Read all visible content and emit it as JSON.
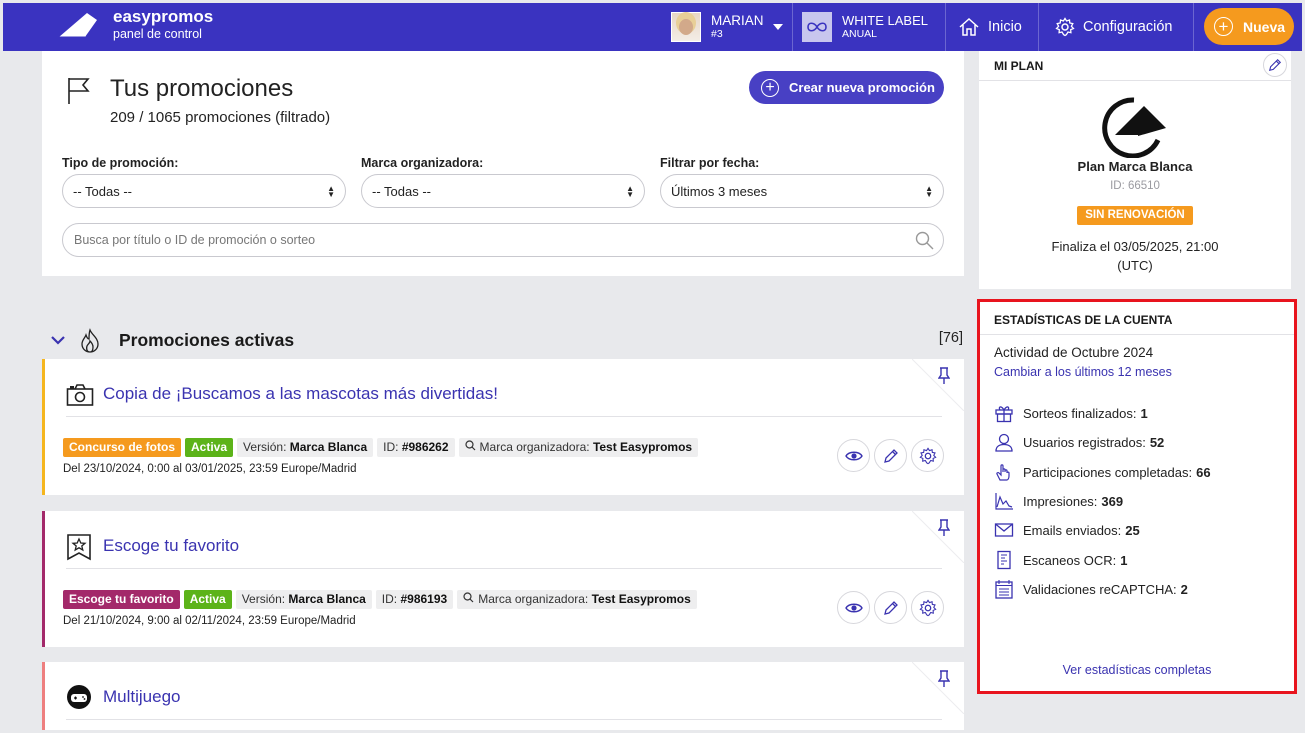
{
  "topbar": {
    "brand_name": "easypromos",
    "brand_sub": "panel de control",
    "user_name": "MARIAN",
    "user_num": "#3",
    "plan_name": "WHITE LABEL",
    "plan_period": "ANUAL",
    "nav_home": "Inicio",
    "nav_config": "Configuración",
    "new_button": "Nueva",
    "bar_color": "#3a33c0",
    "accent_orange": "#f59a1e"
  },
  "promotions": {
    "title": "Tus promociones",
    "count": "209 / 1065 promociones (filtrado)",
    "create_button": "Crear nueva promoción",
    "filters": {
      "type_label": "Tipo de promoción:",
      "type_value": "-- Todas --",
      "brand_label": "Marca organizadora:",
      "brand_value": "-- Todas --",
      "date_label": "Filtrar por fecha:",
      "date_value": "Últimos 3 meses"
    },
    "search_placeholder": "Busca por título o ID de promoción o sorteo"
  },
  "active_section": {
    "title": "Promociones activas",
    "count": "[76]"
  },
  "promo_items": [
    {
      "title": "Copia de ¡Buscamos a las mascotas más divertidas!",
      "type_tag": "Concurso de fotos",
      "type_color": "#f59a1e",
      "status": "Activa",
      "version_label": "Versión:",
      "version_value": "Marca Blanca",
      "id_label": "ID:",
      "id_value": "#986262",
      "brand_label": "Marca organizadora:",
      "brand_value": "Test Easypromos",
      "dates": "Del 23/10/2024, 0:00 al 03/01/2025, 23:59 Europe/Madrid",
      "stripe_color": "#f5b61e",
      "icon": "camera-icon"
    },
    {
      "title": "Escoge tu favorito",
      "type_tag": "Escoge tu favorito",
      "type_color": "#a3296a",
      "status": "Activa",
      "version_label": "Versión:",
      "version_value": "Marca Blanca",
      "id_label": "ID:",
      "id_value": "#986193",
      "brand_label": "Marca organizadora:",
      "brand_value": "Test Easypromos",
      "dates": "Del 21/10/2024, 9:00 al 02/11/2024, 23:59 Europe/Madrid",
      "stripe_color": "#a3296a",
      "icon": "star-ballot-icon"
    },
    {
      "title": "Multijuego",
      "stripe_color": "#ee7f7f",
      "icon": "gamepad-icon"
    }
  ],
  "plan": {
    "header": "MI PLAN",
    "name": "Plan Marca Blanca",
    "id": "ID: 66510",
    "badge": "SIN RENOVACIÓN",
    "ends_line1": "Finaliza el 03/05/2025, 21:00",
    "ends_line2": "(UTC)"
  },
  "stats": {
    "header": "ESTADÍSTICAS DE LA CUENTA",
    "month": "Actividad de Octubre 2024",
    "change_link": "Cambiar a los últimos 12 meses",
    "rows": [
      {
        "label": "Sorteos finalizados:",
        "value": "1",
        "icon": "gift-icon"
      },
      {
        "label": "Usuarios registrados:",
        "value": "52",
        "icon": "user-icon"
      },
      {
        "label": "Participaciones completadas:",
        "value": "66",
        "icon": "hand-icon"
      },
      {
        "label": "Impresiones:",
        "value": "369",
        "icon": "chart-line-icon"
      },
      {
        "label": "Emails enviados:",
        "value": "25",
        "icon": "envelope-icon"
      },
      {
        "label": "Escaneos OCR:",
        "value": "1",
        "icon": "receipt-icon"
      },
      {
        "label": "Validaciones reCAPTCHA:",
        "value": "2",
        "icon": "list-icon"
      }
    ],
    "full_link": "Ver estadísticas completas",
    "highlight_color": "#e8141e"
  }
}
